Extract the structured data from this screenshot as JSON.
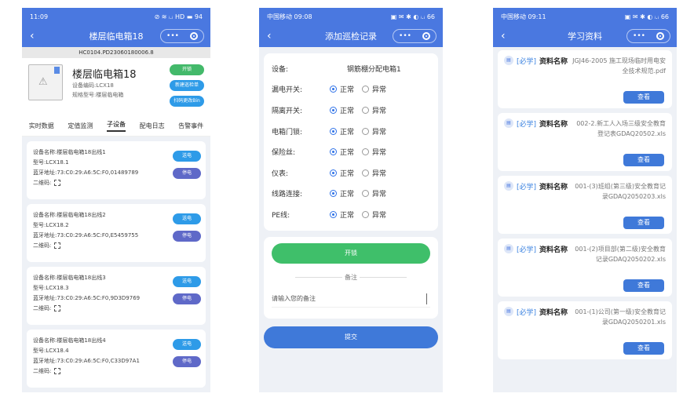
{
  "phone1": {
    "status": {
      "time": "11:09",
      "icons": "⊘ ≋ ᵢ.ᵢ HD ▬ 94"
    },
    "nav": {
      "title": "楼层临电箱18"
    },
    "hc_code": "HC0104.PD23060180006.8",
    "device": {
      "name": "楼层临电箱18",
      "code": "设备编码:LCX18",
      "model": "规格型号:楼层临电箱",
      "buttons": [
        "开锁",
        "新建巡检单",
        "扫码更改Bin"
      ]
    },
    "tabs": [
      "实时数据",
      "定值监测",
      "子设备",
      "配电日志",
      "告警事件"
    ],
    "sub_devices": [
      {
        "name": "设备名称:楼层临电箱18出线1",
        "model": "型号:LCX18.1",
        "bt": "蓝牙地址:73:C0:29:A6:5C:F0,01489789",
        "qr": "二维码:"
      },
      {
        "name": "设备名称:楼层临电箱18出线2",
        "model": "型号:LCX18.2",
        "bt": "蓝牙地址:73:C0:29:A6:5C:F0,E5459755",
        "qr": "二维码:"
      },
      {
        "name": "设备名称:楼层临电箱18出线3",
        "model": "型号:LCX18.3",
        "bt": "蓝牙地址:73:C0:29:A6:5C:F0,9D3D9769",
        "qr": "二维码:"
      },
      {
        "name": "设备名称:楼层临电箱18出线4",
        "model": "型号:LCX18.4",
        "bt": "蓝牙地址:73:C0:29:A6:5C:F0,C33D97A1",
        "qr": "二维码:"
      }
    ],
    "send_label": "送电",
    "stop_label": "停电"
  },
  "phone2": {
    "status": {
      "time": "中国移动 09:08",
      "icons": "▣ ✉ ✱ ◐ ᵢ.ᵢ 66"
    },
    "nav": {
      "title": "添加巡检记录"
    },
    "device_label": "设备:",
    "device_value": "钢筋棚分配电箱1",
    "rows": [
      {
        "label": "漏电开关:"
      },
      {
        "label": "隔离开关:"
      },
      {
        "label": "电箱门锁:"
      },
      {
        "label": "保险丝:"
      },
      {
        "label": "仪表:"
      },
      {
        "label": "线路连接:"
      },
      {
        "label": "PE线:"
      }
    ],
    "option_normal": "正常",
    "option_abnormal": "异常",
    "unlock_label": "开锁",
    "remark_title": "备注",
    "remark_placeholder": "请输入您的备注",
    "submit_label": "提交"
  },
  "phone3": {
    "status": {
      "time": "中国移动 09:11",
      "icons": "▣ ✉ ✱ ◐ ᵢ.ᵢ 66"
    },
    "nav": {
      "title": "学习资料"
    },
    "required_tag": "[必学]",
    "name_key": "资料名称",
    "view_label": "查看",
    "docs": [
      {
        "name": "JGJ46-2005 施工现场临时用电安全技术规范.pdf"
      },
      {
        "name": "002-2.新工人入场三级安全教育登记表GDAQ20502.xls"
      },
      {
        "name": "001-(3)班组(第三级)安全教育记录GDAQ2050203.xls"
      },
      {
        "name": "001-(2)项目部(第二级)安全教育记录GDAQ2050202.xls"
      },
      {
        "name": "001-(1)公司(第一级)安全教育记录GDAQ2050201.xls"
      }
    ]
  }
}
